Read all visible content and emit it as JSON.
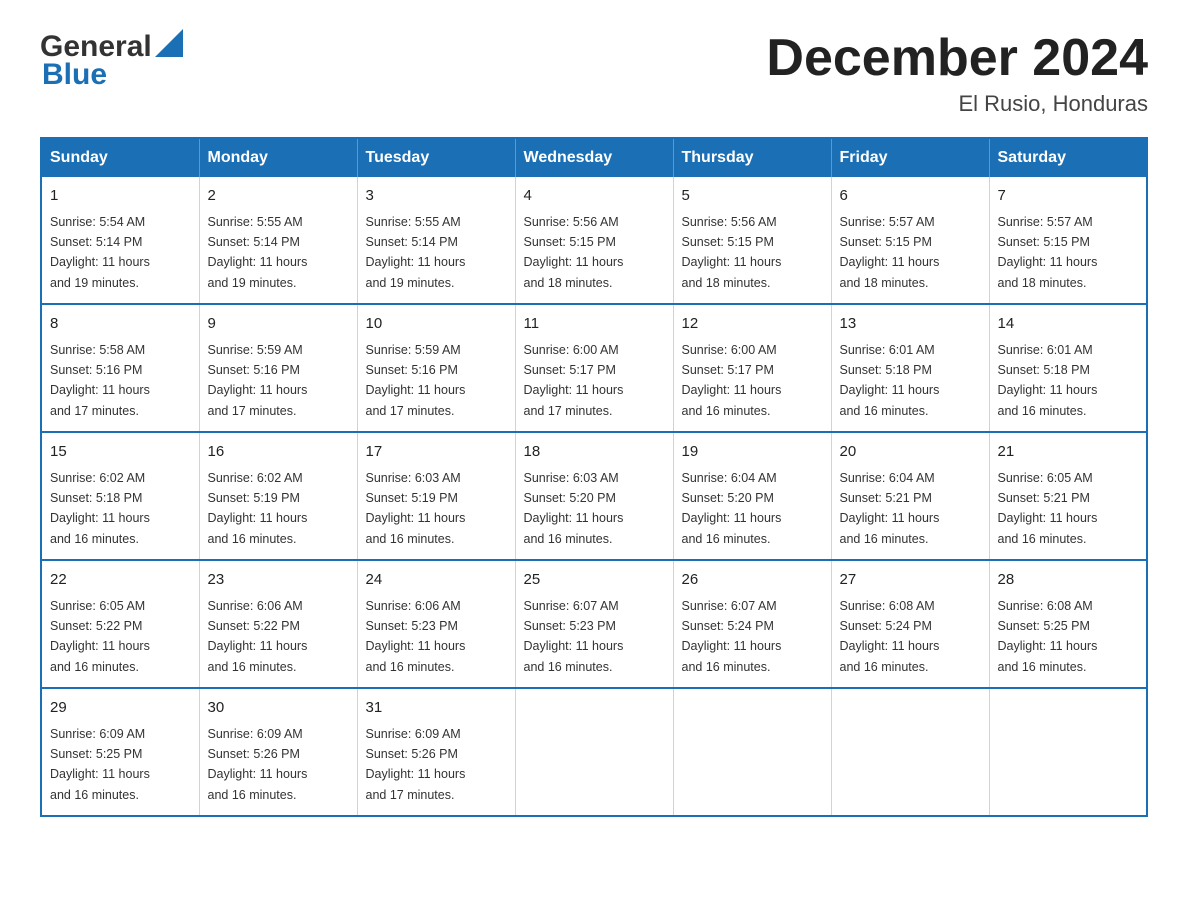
{
  "logo": {
    "general": "General",
    "blue": "Blue",
    "arrow": "▶"
  },
  "title": "December 2024",
  "subtitle": "El Rusio, Honduras",
  "days": [
    "Sunday",
    "Monday",
    "Tuesday",
    "Wednesday",
    "Thursday",
    "Friday",
    "Saturday"
  ],
  "weeks": [
    [
      {
        "day": "1",
        "sunrise": "5:54 AM",
        "sunset": "5:14 PM",
        "daylight": "11 hours and 19 minutes."
      },
      {
        "day": "2",
        "sunrise": "5:55 AM",
        "sunset": "5:14 PM",
        "daylight": "11 hours and 19 minutes."
      },
      {
        "day": "3",
        "sunrise": "5:55 AM",
        "sunset": "5:14 PM",
        "daylight": "11 hours and 19 minutes."
      },
      {
        "day": "4",
        "sunrise": "5:56 AM",
        "sunset": "5:15 PM",
        "daylight": "11 hours and 18 minutes."
      },
      {
        "day": "5",
        "sunrise": "5:56 AM",
        "sunset": "5:15 PM",
        "daylight": "11 hours and 18 minutes."
      },
      {
        "day": "6",
        "sunrise": "5:57 AM",
        "sunset": "5:15 PM",
        "daylight": "11 hours and 18 minutes."
      },
      {
        "day": "7",
        "sunrise": "5:57 AM",
        "sunset": "5:15 PM",
        "daylight": "11 hours and 18 minutes."
      }
    ],
    [
      {
        "day": "8",
        "sunrise": "5:58 AM",
        "sunset": "5:16 PM",
        "daylight": "11 hours and 17 minutes."
      },
      {
        "day": "9",
        "sunrise": "5:59 AM",
        "sunset": "5:16 PM",
        "daylight": "11 hours and 17 minutes."
      },
      {
        "day": "10",
        "sunrise": "5:59 AM",
        "sunset": "5:16 PM",
        "daylight": "11 hours and 17 minutes."
      },
      {
        "day": "11",
        "sunrise": "6:00 AM",
        "sunset": "5:17 PM",
        "daylight": "11 hours and 17 minutes."
      },
      {
        "day": "12",
        "sunrise": "6:00 AM",
        "sunset": "5:17 PM",
        "daylight": "11 hours and 16 minutes."
      },
      {
        "day": "13",
        "sunrise": "6:01 AM",
        "sunset": "5:18 PM",
        "daylight": "11 hours and 16 minutes."
      },
      {
        "day": "14",
        "sunrise": "6:01 AM",
        "sunset": "5:18 PM",
        "daylight": "11 hours and 16 minutes."
      }
    ],
    [
      {
        "day": "15",
        "sunrise": "6:02 AM",
        "sunset": "5:18 PM",
        "daylight": "11 hours and 16 minutes."
      },
      {
        "day": "16",
        "sunrise": "6:02 AM",
        "sunset": "5:19 PM",
        "daylight": "11 hours and 16 minutes."
      },
      {
        "day": "17",
        "sunrise": "6:03 AM",
        "sunset": "5:19 PM",
        "daylight": "11 hours and 16 minutes."
      },
      {
        "day": "18",
        "sunrise": "6:03 AM",
        "sunset": "5:20 PM",
        "daylight": "11 hours and 16 minutes."
      },
      {
        "day": "19",
        "sunrise": "6:04 AM",
        "sunset": "5:20 PM",
        "daylight": "11 hours and 16 minutes."
      },
      {
        "day": "20",
        "sunrise": "6:04 AM",
        "sunset": "5:21 PM",
        "daylight": "11 hours and 16 minutes."
      },
      {
        "day": "21",
        "sunrise": "6:05 AM",
        "sunset": "5:21 PM",
        "daylight": "11 hours and 16 minutes."
      }
    ],
    [
      {
        "day": "22",
        "sunrise": "6:05 AM",
        "sunset": "5:22 PM",
        "daylight": "11 hours and 16 minutes."
      },
      {
        "day": "23",
        "sunrise": "6:06 AM",
        "sunset": "5:22 PM",
        "daylight": "11 hours and 16 minutes."
      },
      {
        "day": "24",
        "sunrise": "6:06 AM",
        "sunset": "5:23 PM",
        "daylight": "11 hours and 16 minutes."
      },
      {
        "day": "25",
        "sunrise": "6:07 AM",
        "sunset": "5:23 PM",
        "daylight": "11 hours and 16 minutes."
      },
      {
        "day": "26",
        "sunrise": "6:07 AM",
        "sunset": "5:24 PM",
        "daylight": "11 hours and 16 minutes."
      },
      {
        "day": "27",
        "sunrise": "6:08 AM",
        "sunset": "5:24 PM",
        "daylight": "11 hours and 16 minutes."
      },
      {
        "day": "28",
        "sunrise": "6:08 AM",
        "sunset": "5:25 PM",
        "daylight": "11 hours and 16 minutes."
      }
    ],
    [
      {
        "day": "29",
        "sunrise": "6:09 AM",
        "sunset": "5:25 PM",
        "daylight": "11 hours and 16 minutes."
      },
      {
        "day": "30",
        "sunrise": "6:09 AM",
        "sunset": "5:26 PM",
        "daylight": "11 hours and 16 minutes."
      },
      {
        "day": "31",
        "sunrise": "6:09 AM",
        "sunset": "5:26 PM",
        "daylight": "11 hours and 17 minutes."
      },
      null,
      null,
      null,
      null
    ]
  ],
  "labels": {
    "sunrise": "Sunrise:",
    "sunset": "Sunset:",
    "daylight": "Daylight:"
  }
}
